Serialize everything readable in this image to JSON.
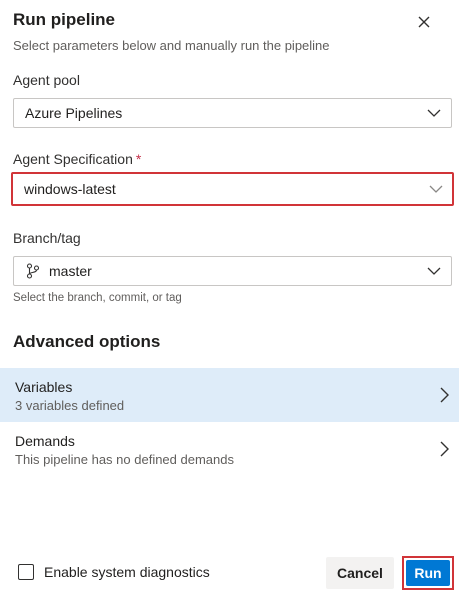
{
  "header": {
    "title": "Run pipeline",
    "subtitle": "Select parameters below and manually run the pipeline"
  },
  "agent_pool": {
    "label": "Agent pool",
    "value": "Azure Pipelines"
  },
  "agent_spec": {
    "label": "Agent Specification",
    "required_mark": "*",
    "value": "windows-latest"
  },
  "branch": {
    "label": "Branch/tag",
    "value": "master",
    "hint": "Select the branch, commit, or tag"
  },
  "advanced": {
    "title": "Advanced options",
    "items": [
      {
        "title": "Variables",
        "subtitle": "3 variables defined",
        "selected": true
      },
      {
        "title": "Demands",
        "subtitle": "This pipeline has no defined demands",
        "selected": false
      }
    ]
  },
  "footer": {
    "diagnostics_label": "Enable system diagnostics",
    "diagnostics_checked": false,
    "cancel_label": "Cancel",
    "run_label": "Run"
  },
  "icons": {
    "close": "close-icon",
    "chevron_down": "chevron-down-icon",
    "chevron_right": "chevron-right-icon",
    "branch": "branch-icon"
  },
  "colors": {
    "accent": "#0078d4",
    "highlight_outline": "#d13438",
    "selected_row": "#deecf9",
    "required": "#c4314b"
  }
}
